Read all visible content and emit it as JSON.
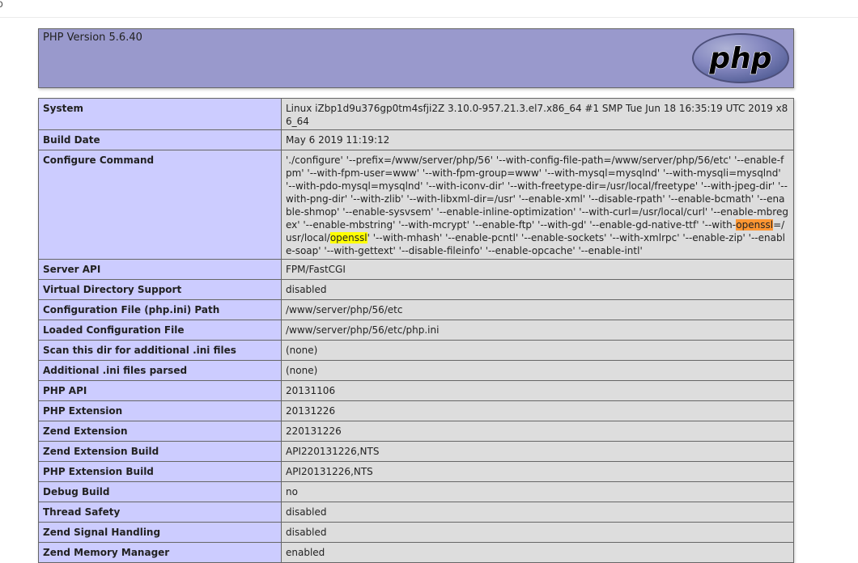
{
  "corner_fragment": "o",
  "header": {
    "title": "PHP Version 5.6.40",
    "logo_text": "php"
  },
  "rows": [
    {
      "label": "System",
      "value": "Linux iZbp1d9u376gp0tm4sfji2Z 3.10.0-957.21.3.el7.x86_64 #1 SMP Tue Jun 18 16:35:19 UTC 2019 x86_64"
    },
    {
      "label": "Build Date",
      "value": "May 6 2019 11:19:12"
    },
    {
      "label": "Configure Command",
      "value_parts": [
        "'./configure' '--prefix=/www/server/php/56' '--with-config-file-path=/www/server/php/56/etc' '--enable-fpm' '--with-fpm-user=www' '--with-fpm-group=www' '--with-mysql=mysqlnd' '--with-mysqli=mysqlnd' '--with-pdo-mysql=mysqlnd' '--with-iconv-dir' '--with-freetype-dir=/usr/local/freetype' '--with-jpeg-dir' '--with-png-dir' '--with-zlib' '--with-libxml-dir=/usr' '--enable-xml' '--disable-rpath' '--enable-bcmath' '--enable-shmop' '--enable-sysvsem' '--enable-inline-optimization' '--with-curl=/usr/local/curl' '--enable-mbregex' '--enable-mbstring' '--with-mcrypt' '--enable-ftp' '--with-gd' '--enable-gd-native-ttf' '--with-",
        "openssl",
        "=/usr/local/",
        "openssl",
        "' '--with-mhash' '--enable-pcntl' '--enable-sockets' '--with-xmlrpc' '--enable-zip' '--enable-soap' '--with-gettext' '--disable-fileinfo' '--enable-opcache' '--enable-intl'"
      ]
    },
    {
      "label": "Server API",
      "value": "FPM/FastCGI"
    },
    {
      "label": "Virtual Directory Support",
      "value": "disabled"
    },
    {
      "label": "Configuration File (php.ini) Path",
      "value": "/www/server/php/56/etc"
    },
    {
      "label": "Loaded Configuration File",
      "value": "/www/server/php/56/etc/php.ini"
    },
    {
      "label": "Scan this dir for additional .ini files",
      "value": "(none)"
    },
    {
      "label": "Additional .ini files parsed",
      "value": "(none)"
    },
    {
      "label": "PHP API",
      "value": "20131106"
    },
    {
      "label": "PHP Extension",
      "value": "20131226"
    },
    {
      "label": "Zend Extension",
      "value": "220131226"
    },
    {
      "label": "Zend Extension Build",
      "value": "API220131226,NTS"
    },
    {
      "label": "PHP Extension Build",
      "value": "API20131226,NTS"
    },
    {
      "label": "Debug Build",
      "value": "no"
    },
    {
      "label": "Thread Safety",
      "value": "disabled"
    },
    {
      "label": "Zend Signal Handling",
      "value": "disabled"
    },
    {
      "label": "Zend Memory Manager",
      "value": "enabled"
    }
  ],
  "colors": {
    "header_bg": "#9999cc",
    "label_bg": "#ccccff",
    "value_bg": "#dddddd",
    "highlight_current": "#ff9632",
    "highlight_match": "#ffff00"
  }
}
